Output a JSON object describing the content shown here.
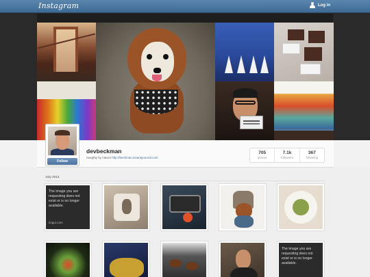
{
  "header": {
    "logo": "Instagram",
    "login_label": "Log in"
  },
  "profile": {
    "username": "devbeckman",
    "bio_text": "naughty by nature ",
    "bio_link": "http://beckman.insanejournal.com",
    "follow_label": "Follow",
    "stats": [
      {
        "value": "705",
        "label": "photos"
      },
      {
        "value": "7.1k",
        "label": "followers"
      },
      {
        "value": "367",
        "label": "following"
      }
    ]
  },
  "gallery": {
    "month_label": "July 2013",
    "imgur_text_1": "The image you are requesting does not exist or is no longer available.",
    "imgur_site_1": "imgur.com",
    "imgur_text_2": "The image you are requesting does not exist or is no longer available."
  },
  "colors": {
    "topbar": "#3d6a95",
    "link": "#3f729b",
    "follow_button": "#4a73a0"
  }
}
